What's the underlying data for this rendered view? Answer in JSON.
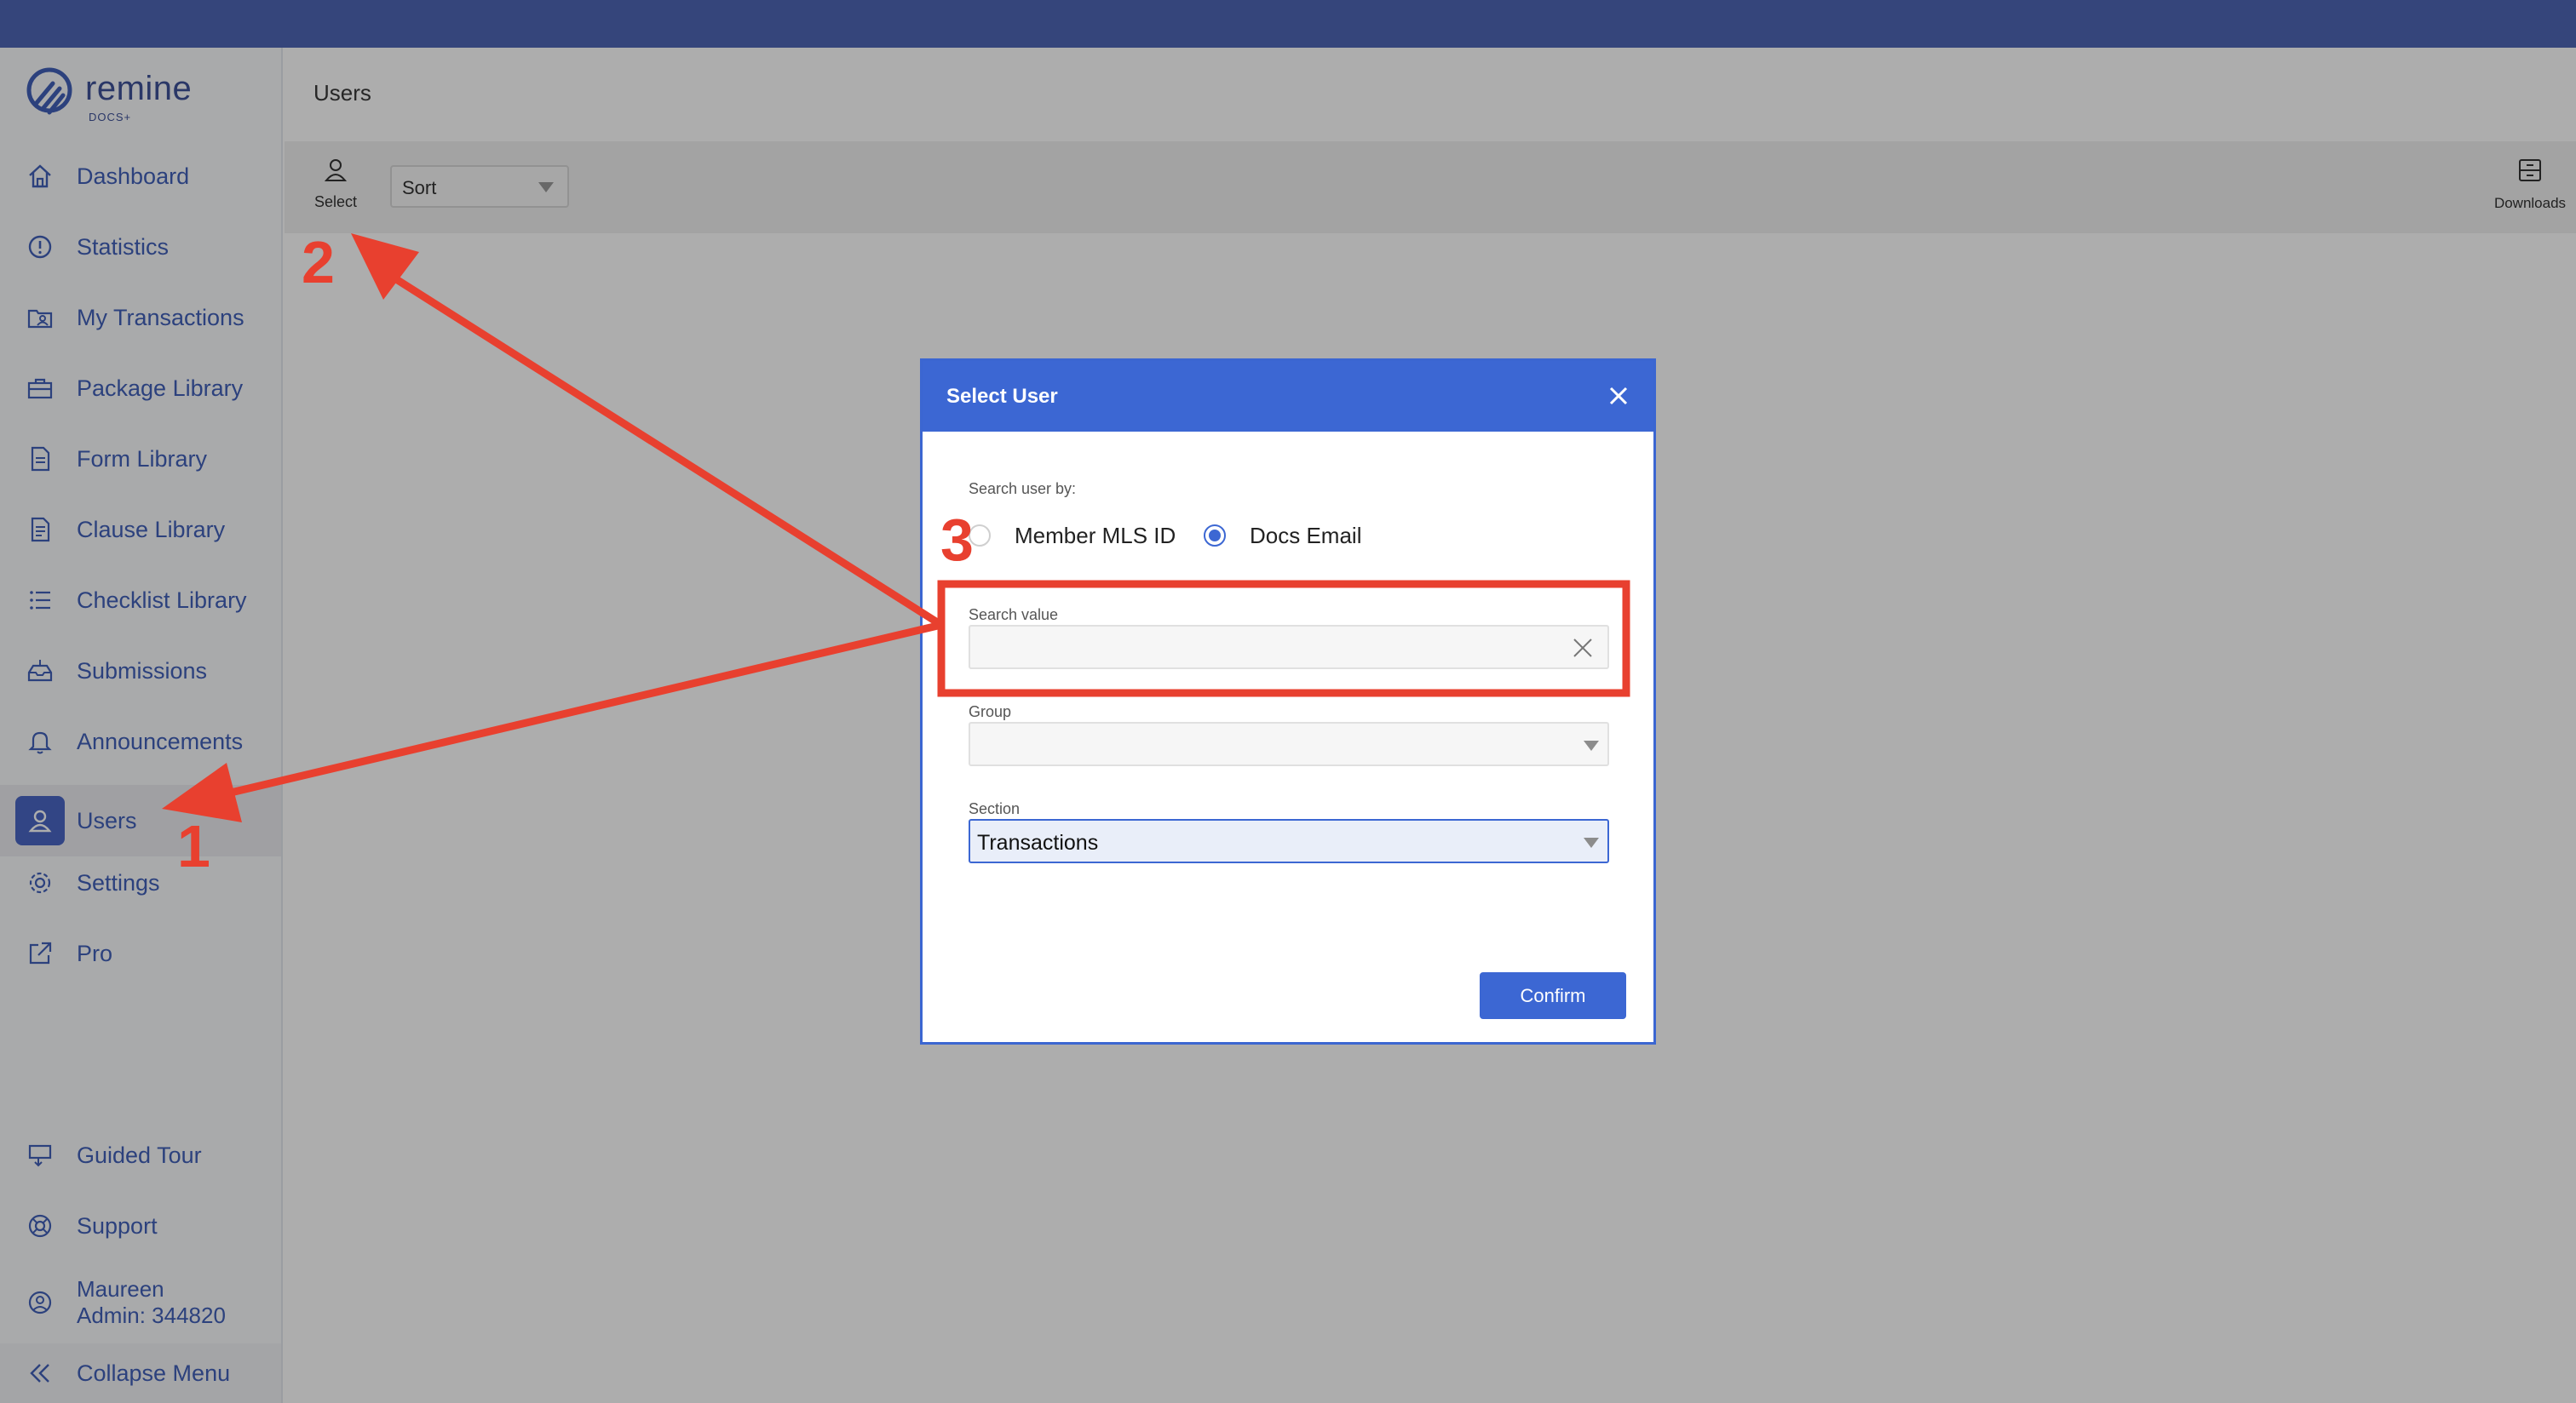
{
  "app": {
    "logo_word": "remine",
    "logo_sub": "DOCS+",
    "brand_color": "#4f66b5",
    "accent_color": "#3c67d3"
  },
  "sidebar": {
    "items": [
      {
        "label": "Dashboard",
        "icon": "home-icon"
      },
      {
        "label": "Statistics",
        "icon": "info-circle-icon"
      },
      {
        "label": "My Transactions",
        "icon": "folder-user-icon"
      },
      {
        "label": "Package Library",
        "icon": "briefcase-icon"
      },
      {
        "label": "Form Library",
        "icon": "document-icon"
      },
      {
        "label": "Clause Library",
        "icon": "document-lines-icon"
      },
      {
        "label": "Checklist Library",
        "icon": "checklist-icon"
      },
      {
        "label": "Submissions",
        "icon": "inbox-icon"
      },
      {
        "label": "Announcements",
        "icon": "bell-icon"
      },
      {
        "label": "Users",
        "icon": "user-icon",
        "active": true
      },
      {
        "label": "Settings",
        "icon": "gear-icon"
      },
      {
        "label": "Pro",
        "icon": "external-link-icon"
      }
    ],
    "bottom": {
      "guided_tour": "Guided Tour",
      "support": "Support",
      "user_name": "Maureen",
      "user_role": "Admin: 344820",
      "collapse": "Collapse Menu"
    }
  },
  "main": {
    "title": "Users",
    "toolbar": {
      "select_label": "Select",
      "sort_value": "Sort",
      "downloads_label": "Downloads"
    }
  },
  "modal": {
    "title": "Select User",
    "search_by_label": "Search user by:",
    "radio_options": [
      {
        "label": "Member MLS ID",
        "selected": false
      },
      {
        "label": "Docs Email",
        "selected": true
      }
    ],
    "search_value_label": "Search value",
    "search_value": "",
    "group_label": "Group",
    "group_value": "",
    "section_label": "Section",
    "section_value": "Transactions",
    "confirm_label": "Confirm"
  },
  "annotations": {
    "step1": "1",
    "step2": "2",
    "step3": "3",
    "color": "#e8402f"
  }
}
